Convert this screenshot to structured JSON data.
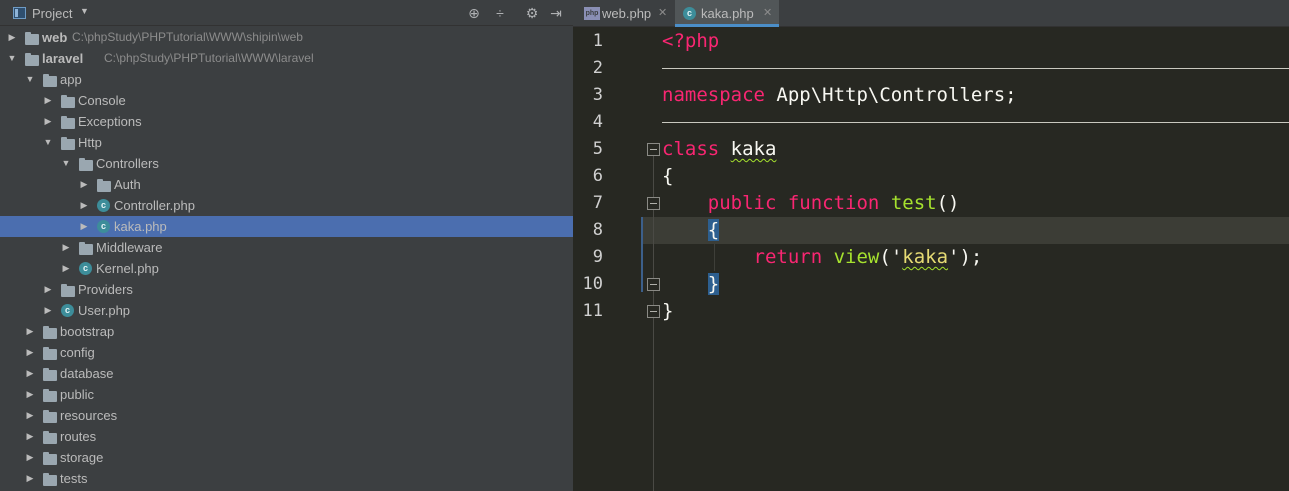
{
  "project_panel": {
    "title": "Project",
    "tools": [
      "crosshair-icon",
      "collapse-icon",
      "gear-icon",
      "hide-icon"
    ],
    "tree": [
      {
        "label": "web",
        "path": "C:\\phpStudy\\PHPTutorial\\WWW\\shipin\\web",
        "bold": true,
        "icon": "folder-icon",
        "expanded": false,
        "depth": 0
      },
      {
        "label": "laravel",
        "path": "C:\\phpStudy\\PHPTutorial\\WWW\\laravel",
        "bold": true,
        "icon": "folder-icon",
        "expanded": true,
        "depth": 0
      },
      {
        "label": "app",
        "icon": "folder-icon",
        "expanded": true,
        "depth": 1
      },
      {
        "label": "Console",
        "icon": "folder-icon",
        "expanded": false,
        "depth": 2
      },
      {
        "label": "Exceptions",
        "icon": "folder-icon",
        "expanded": false,
        "depth": 2
      },
      {
        "label": "Http",
        "icon": "folder-icon",
        "expanded": true,
        "depth": 2
      },
      {
        "label": "Controllers",
        "icon": "folder-icon",
        "expanded": true,
        "depth": 3
      },
      {
        "label": "Auth",
        "icon": "folder-icon",
        "expanded": false,
        "depth": 4
      },
      {
        "label": "Controller.php",
        "icon": "php-class-icon",
        "expanded": false,
        "depth": 4
      },
      {
        "label": "kaka.php",
        "icon": "php-class-icon",
        "expanded": false,
        "depth": 4,
        "selected": true
      },
      {
        "label": "Middleware",
        "icon": "folder-icon",
        "expanded": false,
        "depth": 3
      },
      {
        "label": "Kernel.php",
        "icon": "php-class-icon",
        "expanded": false,
        "depth": 3
      },
      {
        "label": "Providers",
        "icon": "folder-icon",
        "expanded": false,
        "depth": 2
      },
      {
        "label": "User.php",
        "icon": "php-class-icon",
        "expanded": false,
        "depth": 2
      },
      {
        "label": "bootstrap",
        "icon": "folder-icon",
        "expanded": false,
        "depth": 1
      },
      {
        "label": "config",
        "icon": "folder-icon",
        "expanded": false,
        "depth": 1
      },
      {
        "label": "database",
        "icon": "folder-icon",
        "expanded": false,
        "depth": 1
      },
      {
        "label": "public",
        "icon": "folder-icon",
        "expanded": false,
        "depth": 1
      },
      {
        "label": "resources",
        "icon": "folder-icon",
        "expanded": false,
        "depth": 1
      },
      {
        "label": "routes",
        "icon": "folder-icon",
        "expanded": false,
        "depth": 1
      },
      {
        "label": "storage",
        "icon": "folder-icon",
        "expanded": false,
        "depth": 1
      },
      {
        "label": "tests",
        "icon": "folder-icon",
        "expanded": false,
        "depth": 1
      }
    ]
  },
  "editor": {
    "tabs": [
      {
        "label": "web.php",
        "icon": "php-file-icon",
        "active": false
      },
      {
        "label": "kaka.php",
        "icon": "php-class-icon",
        "active": true
      }
    ],
    "current_line": 8,
    "lines": [
      {
        "num": "1",
        "tokens": [
          {
            "t": "<?php",
            "c": "kw"
          }
        ]
      },
      {
        "num": "2",
        "tokens": []
      },
      {
        "num": "3",
        "tokens": [
          {
            "t": "namespace",
            "c": "kw"
          },
          {
            "t": " App\\Http\\Controllers;",
            "c": "plain"
          }
        ]
      },
      {
        "num": "4",
        "tokens": []
      },
      {
        "num": "5",
        "tokens": [
          {
            "t": "class",
            "c": "kw"
          },
          {
            "t": " ",
            "c": "plain"
          },
          {
            "t": "kaka",
            "c": "plain",
            "squiggle": true
          }
        ]
      },
      {
        "num": "6",
        "tokens": [
          {
            "t": "{",
            "c": "plain"
          }
        ]
      },
      {
        "num": "7",
        "tokens": [
          {
            "t": "    ",
            "c": "plain"
          },
          {
            "t": "public",
            "c": "kw"
          },
          {
            "t": " ",
            "c": "plain"
          },
          {
            "t": "function",
            "c": "kw"
          },
          {
            "t": " ",
            "c": "plain"
          },
          {
            "t": "test",
            "c": "fn"
          },
          {
            "t": "()",
            "c": "plain"
          }
        ]
      },
      {
        "num": "8",
        "tokens": [
          {
            "t": "    ",
            "c": "plain"
          },
          {
            "t": "{",
            "c": "brace-hl"
          }
        ]
      },
      {
        "num": "9",
        "tokens": [
          {
            "t": "        ",
            "c": "plain"
          },
          {
            "t": "return",
            "c": "kw"
          },
          {
            "t": " ",
            "c": "plain"
          },
          {
            "t": "view",
            "c": "fn"
          },
          {
            "t": "('",
            "c": "plain"
          },
          {
            "t": "kaka",
            "c": "str",
            "squiggle": true
          },
          {
            "t": "');",
            "c": "plain"
          }
        ]
      },
      {
        "num": "10",
        "tokens": [
          {
            "t": "    ",
            "c": "plain"
          },
          {
            "t": "}",
            "c": "brace-hl"
          }
        ]
      },
      {
        "num": "11",
        "tokens": [
          {
            "t": "}",
            "c": "plain"
          }
        ]
      }
    ]
  },
  "colors": {
    "panel_bg": "#3c3f41",
    "editor_bg": "#272822",
    "selection": "#4b6eaf",
    "keyword": "#f92672",
    "function": "#a6e22e",
    "string": "#e6db74"
  }
}
